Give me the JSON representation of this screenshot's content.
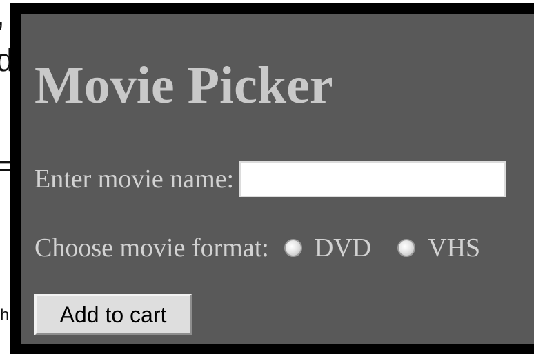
{
  "background": {
    "fragments": [
      ",",
      "d",
      "=",
      "h"
    ]
  },
  "form": {
    "title": "Movie Picker",
    "movie_name_label": "Enter movie name:",
    "movie_name_value": "",
    "format_label": "Choose movie format:",
    "format_options": [
      {
        "label": "DVD",
        "checked": false
      },
      {
        "label": "VHS",
        "checked": false
      }
    ],
    "submit_label": "Add to cart"
  },
  "colors": {
    "panel_bg": "#595959",
    "panel_text": "#c9c9c9",
    "frame": "#000000",
    "button_bg": "#dedede"
  }
}
